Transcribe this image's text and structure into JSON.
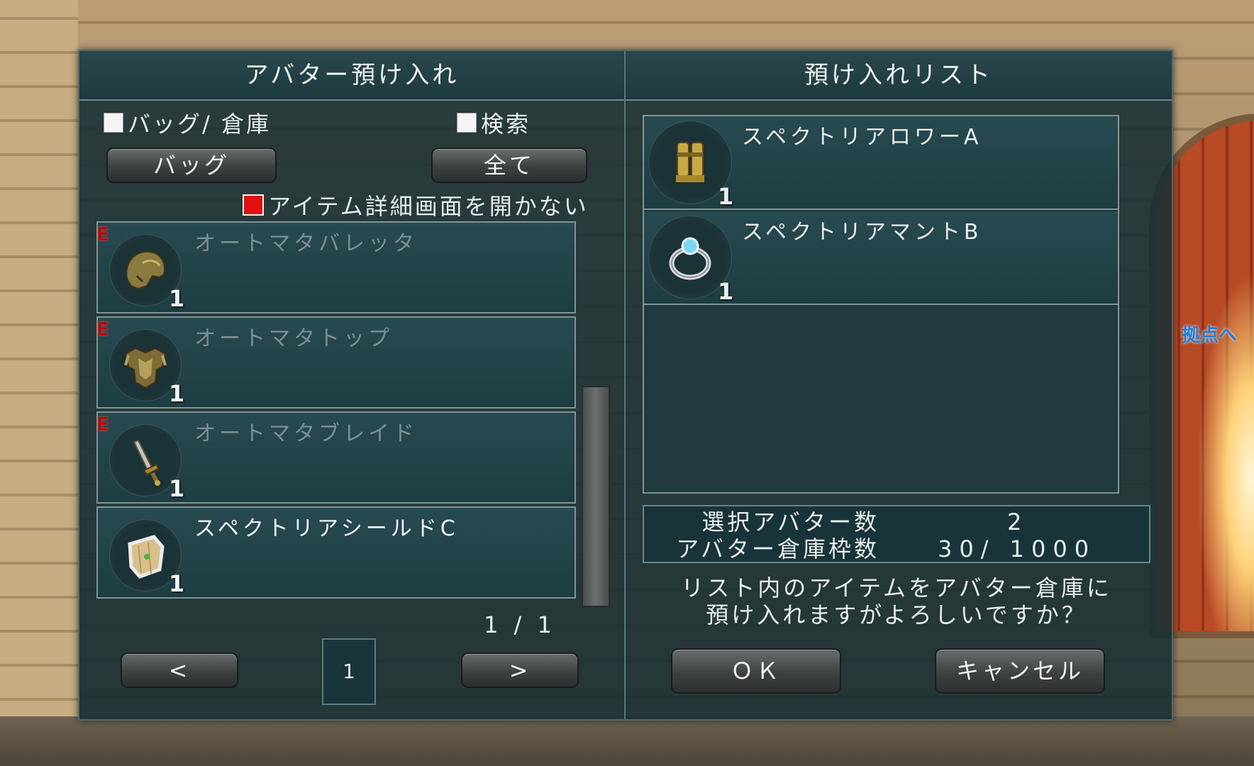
{
  "scene": {
    "base_link": "拠点へ"
  },
  "left_panel": {
    "title": "アバター預け入れ",
    "bag_warehouse_check": "バッグ/ 倉庫",
    "search_check": "検索",
    "bag_button": "バッグ",
    "all_button": "全て",
    "no_detail_check": "アイテム詳細画面を開かない",
    "items": [
      {
        "name": "オートマタバレッタ",
        "qty": "1",
        "equip": "E",
        "icon": "helmet-icon",
        "disabled": true
      },
      {
        "name": "オートマタトップ",
        "qty": "1",
        "equip": "E",
        "icon": "armor-icon",
        "disabled": true
      },
      {
        "name": "オートマタブレイド",
        "qty": "1",
        "equip": "E",
        "icon": "sword-icon",
        "disabled": true
      },
      {
        "name": "スペクトリアシールドC",
        "qty": "1",
        "equip": "",
        "icon": "shield-icon",
        "disabled": false
      }
    ],
    "page_indicator": "1 / 1",
    "current_page": "1",
    "prev_button": "<",
    "next_button": ">"
  },
  "right_panel": {
    "title": "預け入れリスト",
    "items": [
      {
        "name": "スペクトリアロワーA",
        "qty": "1",
        "icon": "leg-armor-icon"
      },
      {
        "name": "スペクトリアマントB",
        "qty": "1",
        "icon": "ring-icon"
      }
    ],
    "selected_label": "選択アバター数",
    "selected_value": "2",
    "storage_label": "アバター倉庫枠数",
    "storage_value": "30/ 1000",
    "confirm_line1": "リスト内のアイテムをアバター倉庫に",
    "confirm_line2": "預け入れますがよろしいですか？",
    "ok_button": "ＯＫ",
    "cancel_button": "キャンセル"
  }
}
